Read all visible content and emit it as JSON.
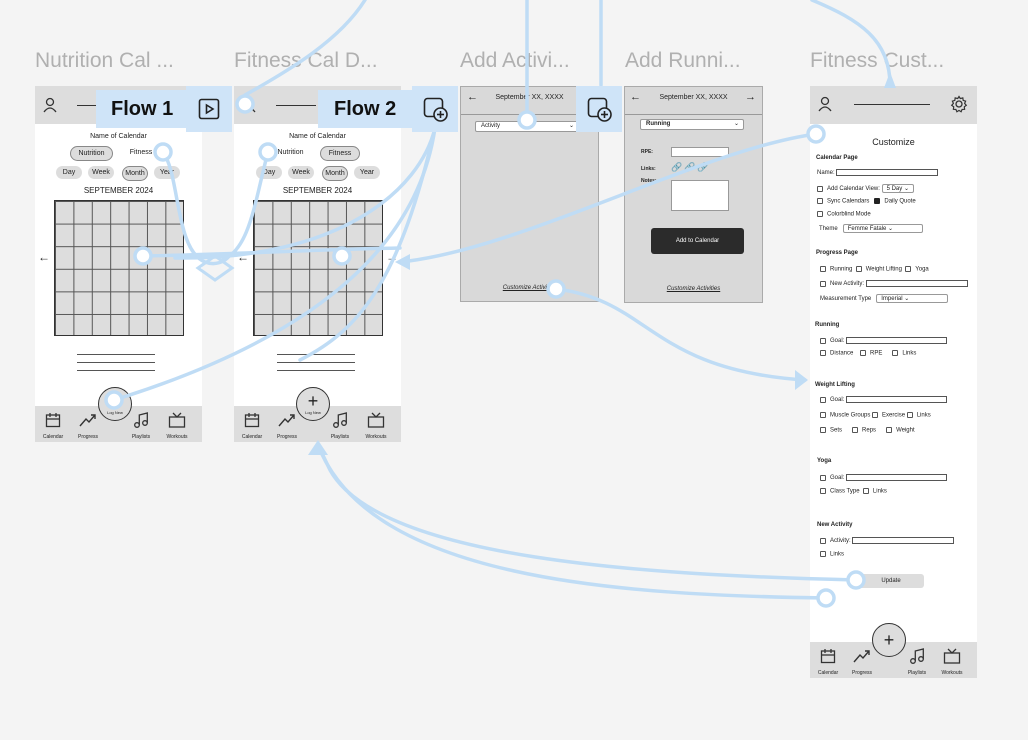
{
  "frames": {
    "nutrition": {
      "title": "Nutrition Cal ...",
      "calendar_name": "Name of Calendar",
      "toggle": [
        "Nutrition",
        "Fitness"
      ],
      "views": [
        "Day",
        "Week",
        "Month",
        "Year"
      ],
      "month": "SEPTEMBER 2024"
    },
    "fitness": {
      "title": "Fitness Cal D...",
      "calendar_name": "Name of Calendar",
      "toggle": [
        "Nutrition",
        "Fitness"
      ],
      "views": [
        "Day",
        "Week",
        "Month",
        "Year"
      ],
      "month": "SEPTEMBER 2024"
    },
    "add_activity": {
      "title": "Add Activi...",
      "date": "September XX, XXXX",
      "activity_select": "Activity",
      "customize_link": "Customize Activities"
    },
    "add_running": {
      "title": "Add Runni...",
      "date": "September XX, XXXX",
      "activity_select": "Running",
      "rpe_label": "RPE:",
      "links_label": "Links:",
      "notes_label": "Notes:",
      "add_button": "Add to Calendar",
      "customize_link": "Customize Activities"
    },
    "customize": {
      "title": "Fitness Cust...",
      "heading": "Customize",
      "calendar_page": {
        "heading": "Calendar Page",
        "name_label": "Name:",
        "add_calendar_view": "Add Calendar View:",
        "view_option": "5 Day",
        "sync_calendars": "Sync Calendars",
        "daily_quote": "Daily Quote",
        "colorblind_mode": "Colorblind Mode",
        "theme_label": "Theme",
        "theme_value": "Femme Fatale"
      },
      "progress_page": {
        "heading": "Progress Page",
        "running": "Running",
        "weight_lifting": "Weight Lifting",
        "yoga": "Yoga",
        "new_activity": "New Activity:",
        "measurement_label": "Measurement Type",
        "measurement_value": "Imperial"
      },
      "running": {
        "heading": "Running",
        "goal": "Goal:",
        "distance": "Distance",
        "rpe": "RPE",
        "links": "Links"
      },
      "weight_lifting": {
        "heading": "Weight Lifting",
        "goal": "Goal:",
        "muscle_groups": "Muscle Groups",
        "exercise": "Exercise",
        "links": "Links",
        "sets": "Sets",
        "reps": "Reps",
        "weight": "Weight"
      },
      "yoga": {
        "heading": "Yoga",
        "goal": "Goal:",
        "class_type": "Class Type",
        "links": "Links"
      },
      "new_activity": {
        "heading": "New Activity",
        "activity": "Activity:",
        "links": "Links"
      },
      "update_button": "Update"
    }
  },
  "navbar": {
    "calendar": "Calendar",
    "progress": "Progress",
    "playlists": "Playlists",
    "workouts": "Workouts",
    "log_new": "Log New"
  },
  "flows": {
    "flow1": "Flow 1",
    "flow2": "Flow 2"
  },
  "colors": {
    "connector": "#bfdcf5",
    "badge": "#cfe4f8",
    "canvas": "#f4f4f4"
  }
}
